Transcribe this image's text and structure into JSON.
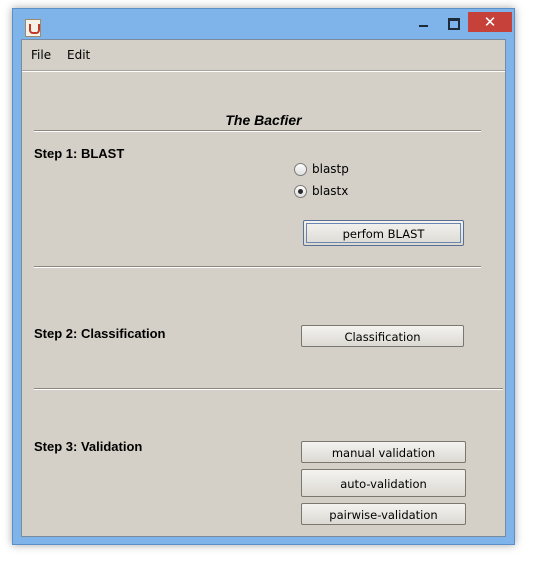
{
  "menu": {
    "file": "File",
    "edit": "Edit"
  },
  "app_title": "The Bacfier",
  "step1": {
    "label": "Step 1: BLAST",
    "radio_blastp": "blastp",
    "radio_blastx": "blastx",
    "selected": "blastx",
    "button": "perfom BLAST"
  },
  "step2": {
    "label": "Step 2: Classification",
    "button": "Classification"
  },
  "step3": {
    "label": "Step 3: Validation",
    "btn_manual": "manual validation",
    "btn_auto": "auto-validation",
    "btn_pairwise": "pairwise-validation"
  },
  "colors": {
    "window_frame": "#7eb4ea",
    "client_bg": "#d4d0c8",
    "close_button": "#c7413b"
  }
}
